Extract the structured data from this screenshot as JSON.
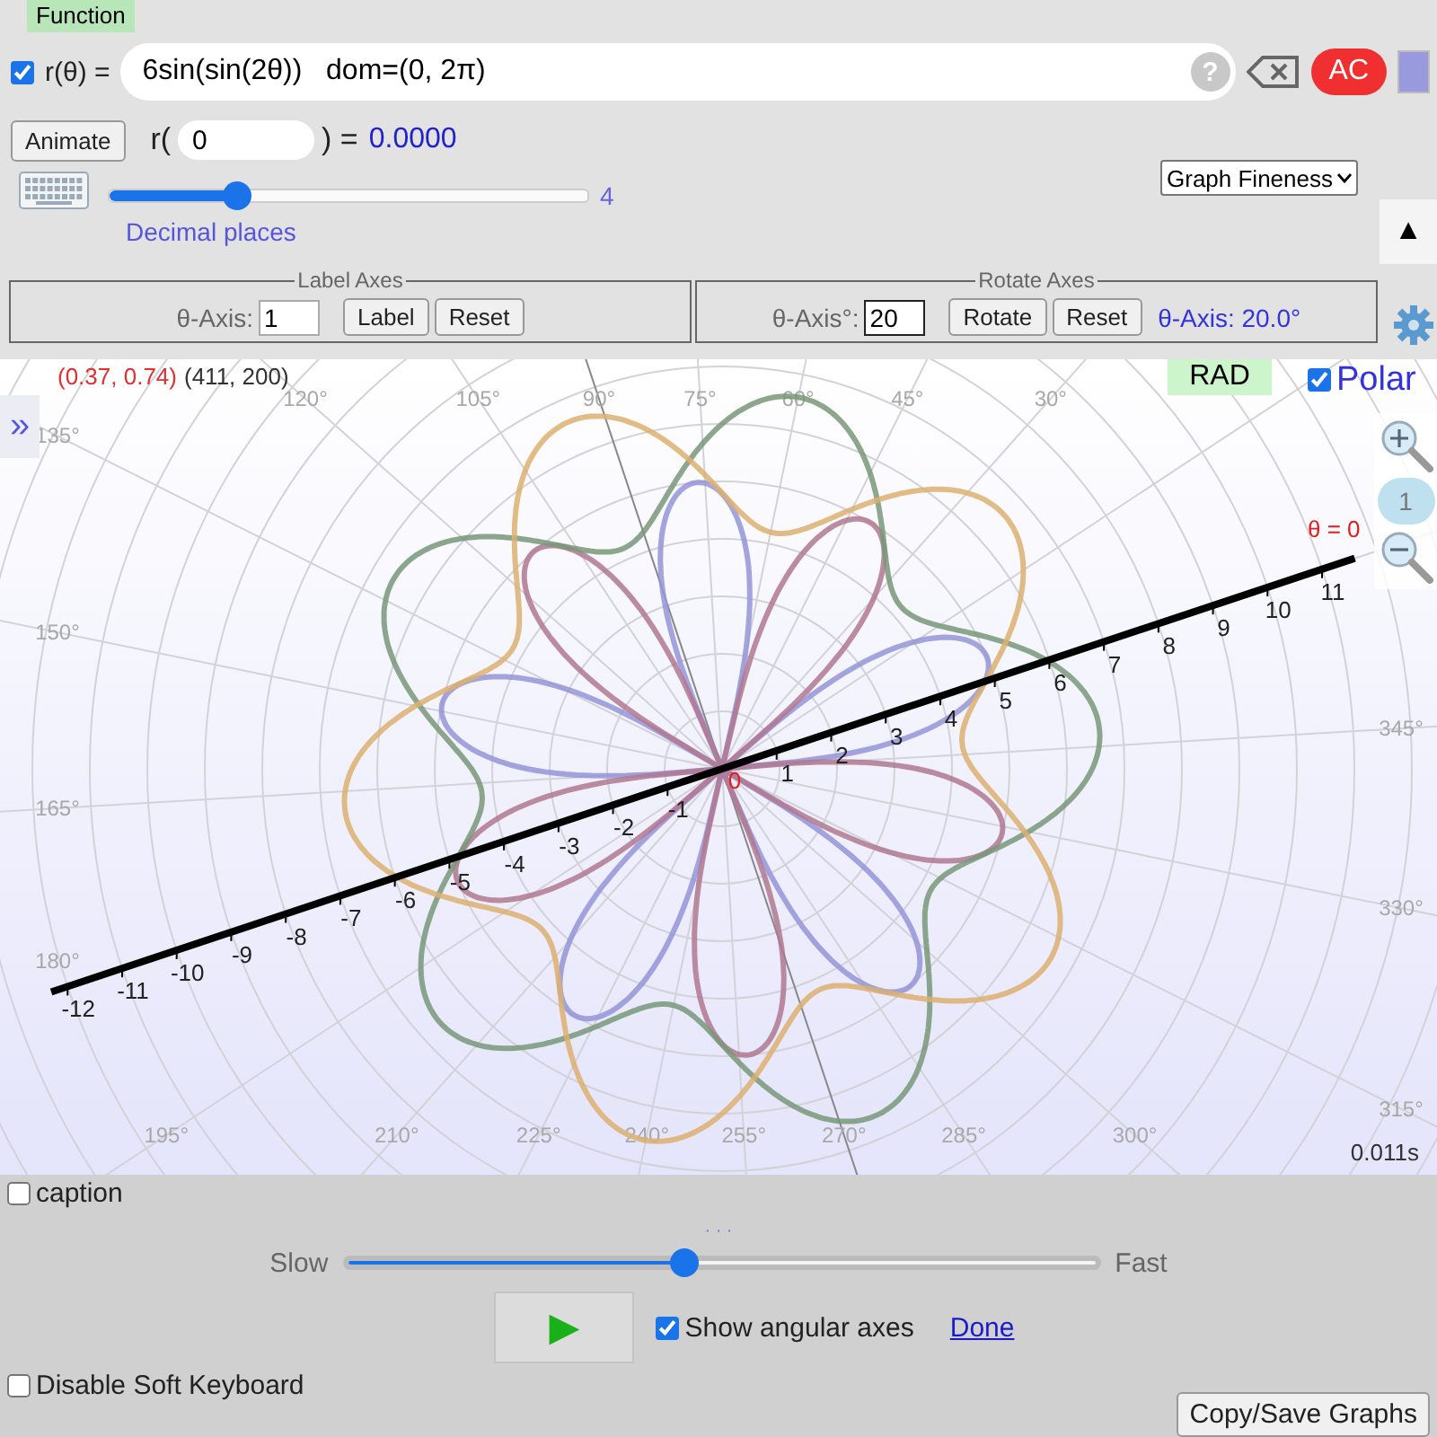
{
  "function_tag": "Function",
  "expression": {
    "enabled": true,
    "label": "r(θ) =",
    "value": "6sin(sin(2θ))   dom=(0, 2π)",
    "help": "?",
    "clear_all": "AC",
    "color": "#9999dd"
  },
  "evaluate": {
    "button": "Animate",
    "prefix": "r(",
    "input": "0",
    "suffix": ") =",
    "result": "0.0000"
  },
  "decimal_places": {
    "level": 0.27,
    "reading": "4",
    "label": "Decimal places"
  },
  "graph_fineness": "Graph Fineness",
  "collapse_button": "▲",
  "label_axes": {
    "legend": "Label Axes",
    "field_label": "θ-Axis:",
    "value": "1",
    "buttons": [
      "Label",
      "Reset"
    ]
  },
  "rotate_axes": {
    "legend": "Rotate Axes",
    "field_label": "θ-Axis°:",
    "value": "20",
    "buttons": [
      "Rotate",
      "Reset"
    ],
    "reading": "θ-Axis: 20.0°"
  },
  "plot": {
    "cursor_math": "(0.37, 0.74)",
    "cursor_pixel": "(411, 200)",
    "expand_button": "»",
    "mode": "RAD",
    "polar": true,
    "polar_label": "Polar",
    "angle_labels": [
      "120°",
      "105°",
      "90°",
      "75°",
      "60°",
      "45°",
      "30°",
      "135°",
      "150°",
      "165°",
      "180°",
      "195°",
      "210°",
      "225°",
      "240°",
      "255°",
      "270°",
      "285°",
      "300°",
      "345°",
      "330°",
      "315°"
    ],
    "axis_ticks": [
      "-12",
      "-11",
      "-10",
      "-9",
      "-8",
      "-7",
      "-6",
      "-5",
      "-4",
      "-3",
      "-2",
      "-1",
      "1",
      "2",
      "3",
      "4",
      "5",
      "6",
      "7",
      "8",
      "9",
      "10",
      "11"
    ],
    "origin_label": "0",
    "axis_label": "θ = 0",
    "zoom_level": "1",
    "timing": "0.011s"
  },
  "caption": {
    "checked": false,
    "label": "caption"
  },
  "speed": {
    "handle": "· · ·",
    "slow": "Slow",
    "fast": "Fast",
    "level": 0.45
  },
  "play_button": "▶",
  "show_angular_axes": {
    "checked": true,
    "label": "Show angular axes"
  },
  "done_link": "Done",
  "disable_keyboard": {
    "checked": false,
    "label": "Disable Soft Keyboard"
  },
  "copy_button": "Copy/Save Graphs"
}
